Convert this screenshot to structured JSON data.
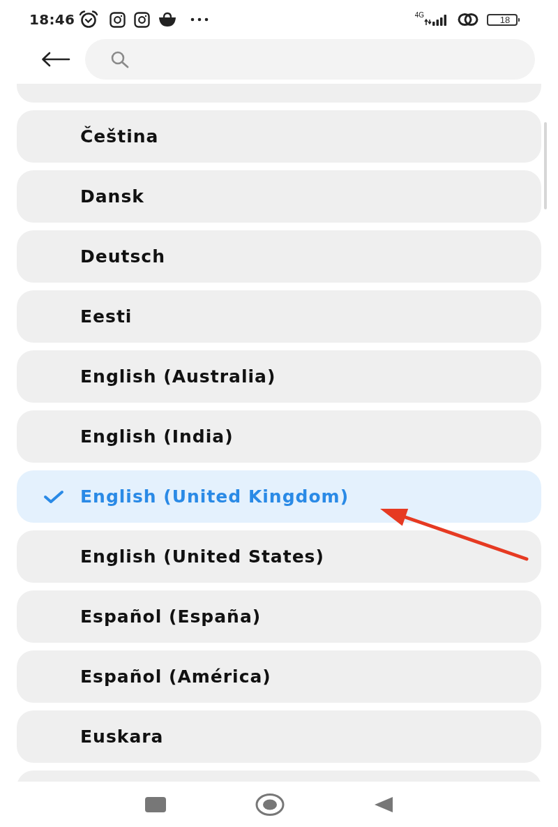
{
  "status_bar": {
    "time": "18:46",
    "network": "4G",
    "battery": "18"
  },
  "languages": [
    {
      "label": "Čeština",
      "selected": false
    },
    {
      "label": "Dansk",
      "selected": false
    },
    {
      "label": "Deutsch",
      "selected": false
    },
    {
      "label": "Eesti",
      "selected": false
    },
    {
      "label": "English (Australia)",
      "selected": false
    },
    {
      "label": "English (India)",
      "selected": false
    },
    {
      "label": "English (United Kingdom)",
      "selected": true
    },
    {
      "label": "English (United States)",
      "selected": false
    },
    {
      "label": "Español (España)",
      "selected": false
    },
    {
      "label": "Español (América)",
      "selected": false
    },
    {
      "label": "Euskara",
      "selected": false
    }
  ]
}
